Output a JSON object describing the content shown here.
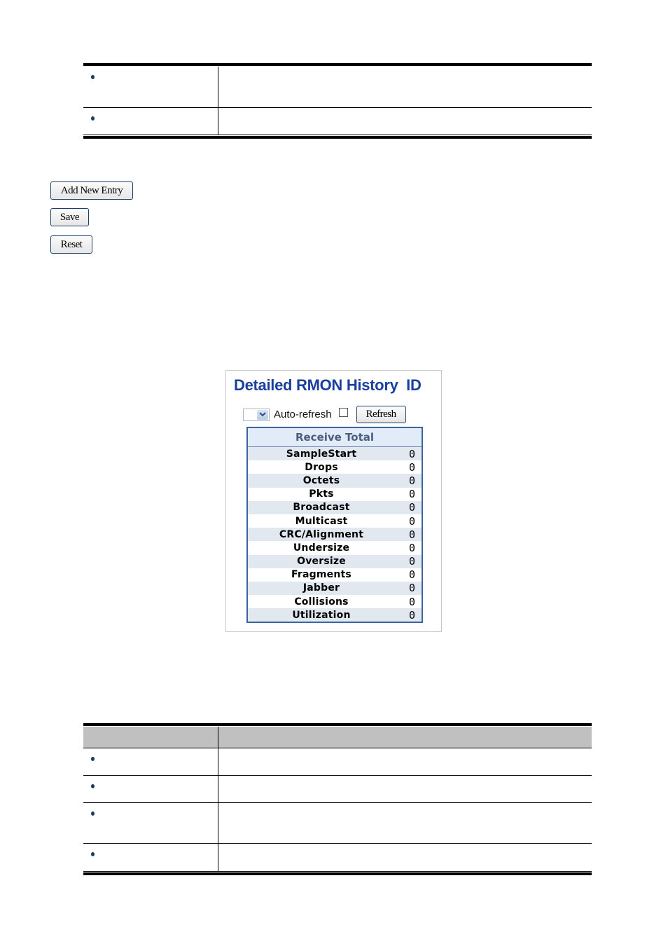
{
  "top_table": {
    "rows": [
      {
        "label": "",
        "description": ""
      },
      {
        "label": "",
        "description": ""
      }
    ]
  },
  "buttons": {
    "add_new_entry": "Add New Entry",
    "save": "Save",
    "reset": "Reset"
  },
  "panel": {
    "title": "Detailed RMON History  ID",
    "select_value": "",
    "auto_refresh_label": "Auto-refresh",
    "auto_refresh_checked": false,
    "refresh_label": "Refresh",
    "receive_total": {
      "header": "Receive Total",
      "rows": [
        {
          "label": "SampleStart",
          "value": "0"
        },
        {
          "label": "Drops",
          "value": "0"
        },
        {
          "label": "Octets",
          "value": "0"
        },
        {
          "label": "Pkts",
          "value": "0"
        },
        {
          "label": "Broadcast",
          "value": "0"
        },
        {
          "label": "Multicast",
          "value": "0"
        },
        {
          "label": "CRC/Alignment",
          "value": "0"
        },
        {
          "label": "Undersize",
          "value": "0"
        },
        {
          "label": "Oversize",
          "value": "0"
        },
        {
          "label": "Fragments",
          "value": "0"
        },
        {
          "label": "Jabber",
          "value": "0"
        },
        {
          "label": "Collisions",
          "value": "0"
        },
        {
          "label": "Utilization",
          "value": "0"
        }
      ]
    }
  },
  "bottom_table": {
    "header": {
      "object": "",
      "description": ""
    },
    "rows": [
      {
        "label": "",
        "description": ""
      },
      {
        "label": "",
        "description": ""
      },
      {
        "label": "",
        "description": ""
      },
      {
        "label": "",
        "description": ""
      }
    ]
  },
  "colors": {
    "title_blue": "#1a3fa0",
    "table_border": "#3a64a0",
    "header_bg": "#e2ecf8",
    "bottom_header_gray": "#c0c0c0"
  }
}
